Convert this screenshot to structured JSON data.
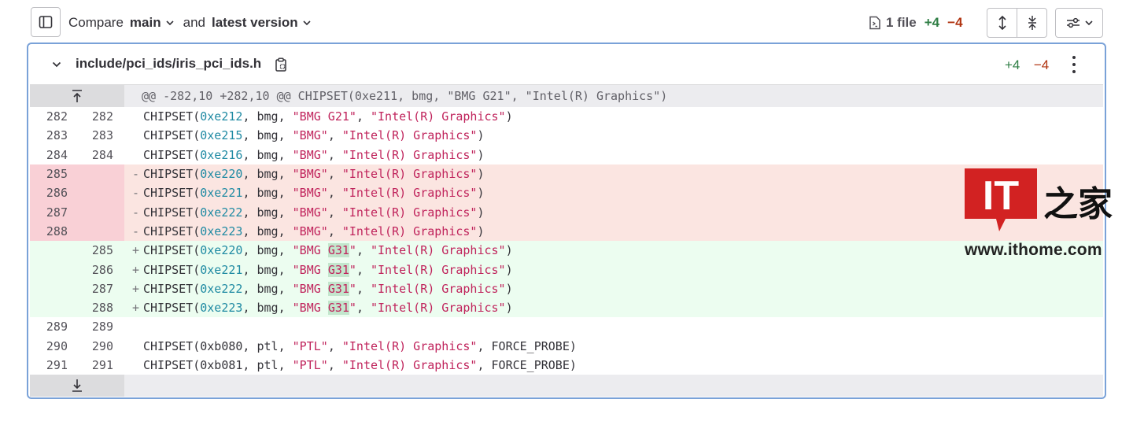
{
  "compare": {
    "prefix": "Compare",
    "source_ref": "main",
    "joiner": "and",
    "target_ref": "latest version"
  },
  "summary": {
    "files": "1 file",
    "additions": "+4",
    "deletions": "−4"
  },
  "file": {
    "path": "include/pci_ids/iris_pci_ids.h",
    "additions": "+4",
    "deletions": "−4"
  },
  "hunk_header": "@@ -282,10 +282,10 @@ CHIPSET(0xe211, bmg, \"BMG G21\", \"Intel(R) Graphics\")",
  "rows": [
    {
      "type": "context",
      "old": "282",
      "new": "282",
      "marker": "",
      "parts": [
        [
          "",
          "CHIPSET("
        ],
        [
          "hex",
          "0xe212"
        ],
        [
          "",
          ", bmg, "
        ],
        [
          "str",
          "\"BMG G21\""
        ],
        [
          "",
          ", "
        ],
        [
          "str",
          "\"Intel(R) Graphics\""
        ],
        [
          "",
          ")"
        ]
      ]
    },
    {
      "type": "context",
      "old": "283",
      "new": "283",
      "marker": "",
      "parts": [
        [
          "",
          "CHIPSET("
        ],
        [
          "hex",
          "0xe215"
        ],
        [
          "",
          ", bmg, "
        ],
        [
          "str",
          "\"BMG\""
        ],
        [
          "",
          ", "
        ],
        [
          "str",
          "\"Intel(R) Graphics\""
        ],
        [
          "",
          ")"
        ]
      ]
    },
    {
      "type": "context",
      "old": "284",
      "new": "284",
      "marker": "",
      "parts": [
        [
          "",
          "CHIPSET("
        ],
        [
          "hex",
          "0xe216"
        ],
        [
          "",
          ", bmg, "
        ],
        [
          "str",
          "\"BMG\""
        ],
        [
          "",
          ", "
        ],
        [
          "str",
          "\"Intel(R) Graphics\""
        ],
        [
          "",
          ")"
        ]
      ]
    },
    {
      "type": "removed",
      "old": "285",
      "new": "",
      "marker": "-",
      "parts": [
        [
          "",
          "CHIPSET("
        ],
        [
          "hex",
          "0xe220"
        ],
        [
          "",
          ", bmg, "
        ],
        [
          "str",
          "\"BMG\""
        ],
        [
          "",
          ", "
        ],
        [
          "str",
          "\"Intel(R) Graphics\""
        ],
        [
          "",
          ")"
        ]
      ]
    },
    {
      "type": "removed",
      "old": "286",
      "new": "",
      "marker": "-",
      "parts": [
        [
          "",
          "CHIPSET("
        ],
        [
          "hex",
          "0xe221"
        ],
        [
          "",
          ", bmg, "
        ],
        [
          "str",
          "\"BMG\""
        ],
        [
          "",
          ", "
        ],
        [
          "str",
          "\"Intel(R) Graphics\""
        ],
        [
          "",
          ")"
        ]
      ]
    },
    {
      "type": "removed",
      "old": "287",
      "new": "",
      "marker": "-",
      "parts": [
        [
          "",
          "CHIPSET("
        ],
        [
          "hex",
          "0xe222"
        ],
        [
          "",
          ", bmg, "
        ],
        [
          "str",
          "\"BMG\""
        ],
        [
          "",
          ", "
        ],
        [
          "str",
          "\"Intel(R) Graphics\""
        ],
        [
          "",
          ")"
        ]
      ]
    },
    {
      "type": "removed",
      "old": "288",
      "new": "",
      "marker": "-",
      "parts": [
        [
          "",
          "CHIPSET("
        ],
        [
          "hex",
          "0xe223"
        ],
        [
          "",
          ", bmg, "
        ],
        [
          "str",
          "\"BMG\""
        ],
        [
          "",
          ", "
        ],
        [
          "str",
          "\"Intel(R) Graphics\""
        ],
        [
          "",
          ")"
        ]
      ]
    },
    {
      "type": "added",
      "old": "",
      "new": "285",
      "marker": "+",
      "parts": [
        [
          "",
          "CHIPSET("
        ],
        [
          "hex",
          "0xe220"
        ],
        [
          "",
          ", bmg, "
        ],
        [
          "str",
          "\"BMG "
        ],
        [
          "strhl",
          "G31"
        ],
        [
          "str",
          "\""
        ],
        [
          "",
          ", "
        ],
        [
          "str",
          "\"Intel(R) Graphics\""
        ],
        [
          "",
          ")"
        ]
      ]
    },
    {
      "type": "added",
      "old": "",
      "new": "286",
      "marker": "+",
      "parts": [
        [
          "",
          "CHIPSET("
        ],
        [
          "hex",
          "0xe221"
        ],
        [
          "",
          ", bmg, "
        ],
        [
          "str",
          "\"BMG "
        ],
        [
          "strhl",
          "G31"
        ],
        [
          "str",
          "\""
        ],
        [
          "",
          ", "
        ],
        [
          "str",
          "\"Intel(R) Graphics\""
        ],
        [
          "",
          ")"
        ]
      ]
    },
    {
      "type": "added",
      "old": "",
      "new": "287",
      "marker": "+",
      "parts": [
        [
          "",
          "CHIPSET("
        ],
        [
          "hex",
          "0xe222"
        ],
        [
          "",
          ", bmg, "
        ],
        [
          "str",
          "\"BMG "
        ],
        [
          "strhl",
          "G31"
        ],
        [
          "str",
          "\""
        ],
        [
          "",
          ", "
        ],
        [
          "str",
          "\"Intel(R) Graphics\""
        ],
        [
          "",
          ")"
        ]
      ]
    },
    {
      "type": "added",
      "old": "",
      "new": "288",
      "marker": "+",
      "parts": [
        [
          "",
          "CHIPSET("
        ],
        [
          "hex",
          "0xe223"
        ],
        [
          "",
          ", bmg, "
        ],
        [
          "str",
          "\"BMG "
        ],
        [
          "strhl",
          "G31"
        ],
        [
          "str",
          "\""
        ],
        [
          "",
          ", "
        ],
        [
          "str",
          "\"Intel(R) Graphics\""
        ],
        [
          "",
          ")"
        ]
      ]
    },
    {
      "type": "context",
      "old": "289",
      "new": "289",
      "marker": "",
      "parts": []
    },
    {
      "type": "context",
      "old": "290",
      "new": "290",
      "marker": "",
      "parts": [
        [
          "",
          "CHIPSET(0xb080, ptl, "
        ],
        [
          "str",
          "\"PTL\""
        ],
        [
          "",
          ", "
        ],
        [
          "str",
          "\"Intel(R) Graphics\""
        ],
        [
          "",
          ", FORCE_PROBE)"
        ]
      ]
    },
    {
      "type": "context",
      "old": "291",
      "new": "291",
      "marker": "",
      "parts": [
        [
          "",
          "CHIPSET(0xb081, ptl, "
        ],
        [
          "str",
          "\"PTL\""
        ],
        [
          "",
          ", "
        ],
        [
          "str",
          "\"Intel(R) Graphics\""
        ],
        [
          "",
          ", FORCE_PROBE)"
        ]
      ]
    }
  ],
  "watermark": {
    "logo_letters": "IT",
    "logo_brand": "之家",
    "site": "www.ithome.com"
  },
  "colors": {
    "accent_border": "#7aa2d8",
    "added": "#2f7e45",
    "deleted": "#b13512",
    "logo_red": "#d22222"
  },
  "icons": {
    "sidebar_toggle": "sidebar-icon",
    "file_summary": "file-diff-icon",
    "expand_all": "expand-vertical-icon",
    "collapse_all": "collapse-vertical-icon",
    "settings": "preferences-icon",
    "copy_path": "clipboard-icon",
    "more": "kebab-icon"
  }
}
